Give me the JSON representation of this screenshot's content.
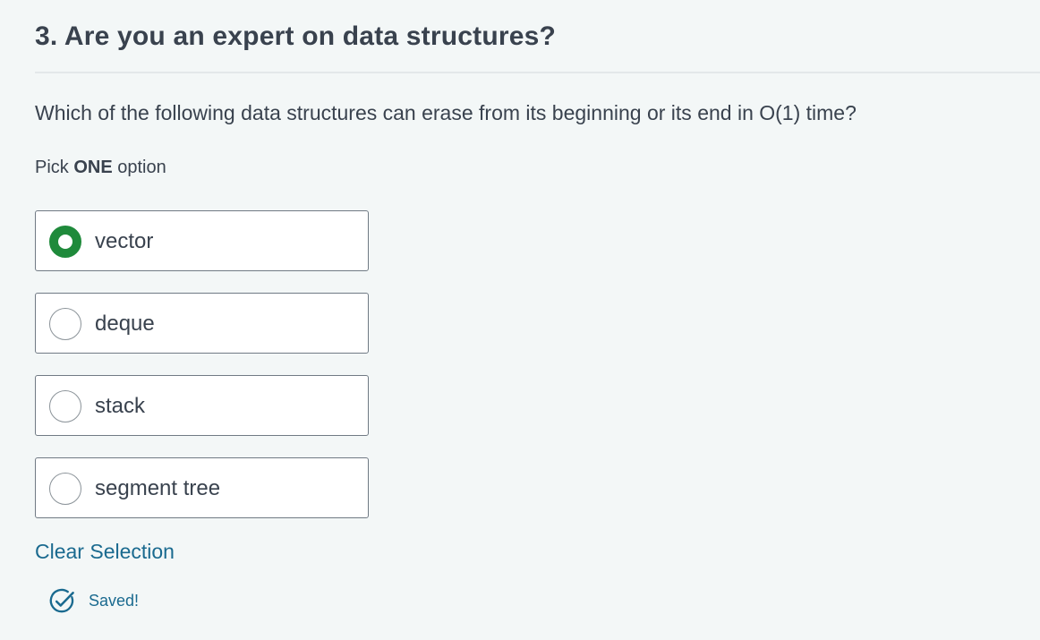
{
  "question": {
    "title": "3. Are you an expert on data structures?",
    "text": "Which of the following data structures can erase from its beginning or its end in O(1) time?",
    "instruction_prefix": "Pick ",
    "instruction_emphasis": "ONE",
    "instruction_suffix": " option"
  },
  "options": [
    {
      "label": "vector",
      "selected": true
    },
    {
      "label": "deque",
      "selected": false
    },
    {
      "label": "stack",
      "selected": false
    },
    {
      "label": "segment tree",
      "selected": false
    }
  ],
  "actions": {
    "clear_label": "Clear Selection"
  },
  "status": {
    "saved_label": "Saved!",
    "icon": "check-circle-icon"
  },
  "colors": {
    "accent_selected": "#1f8a3b",
    "link": "#1a6a8f",
    "text": "#39424e",
    "background": "#f3f7f7"
  }
}
